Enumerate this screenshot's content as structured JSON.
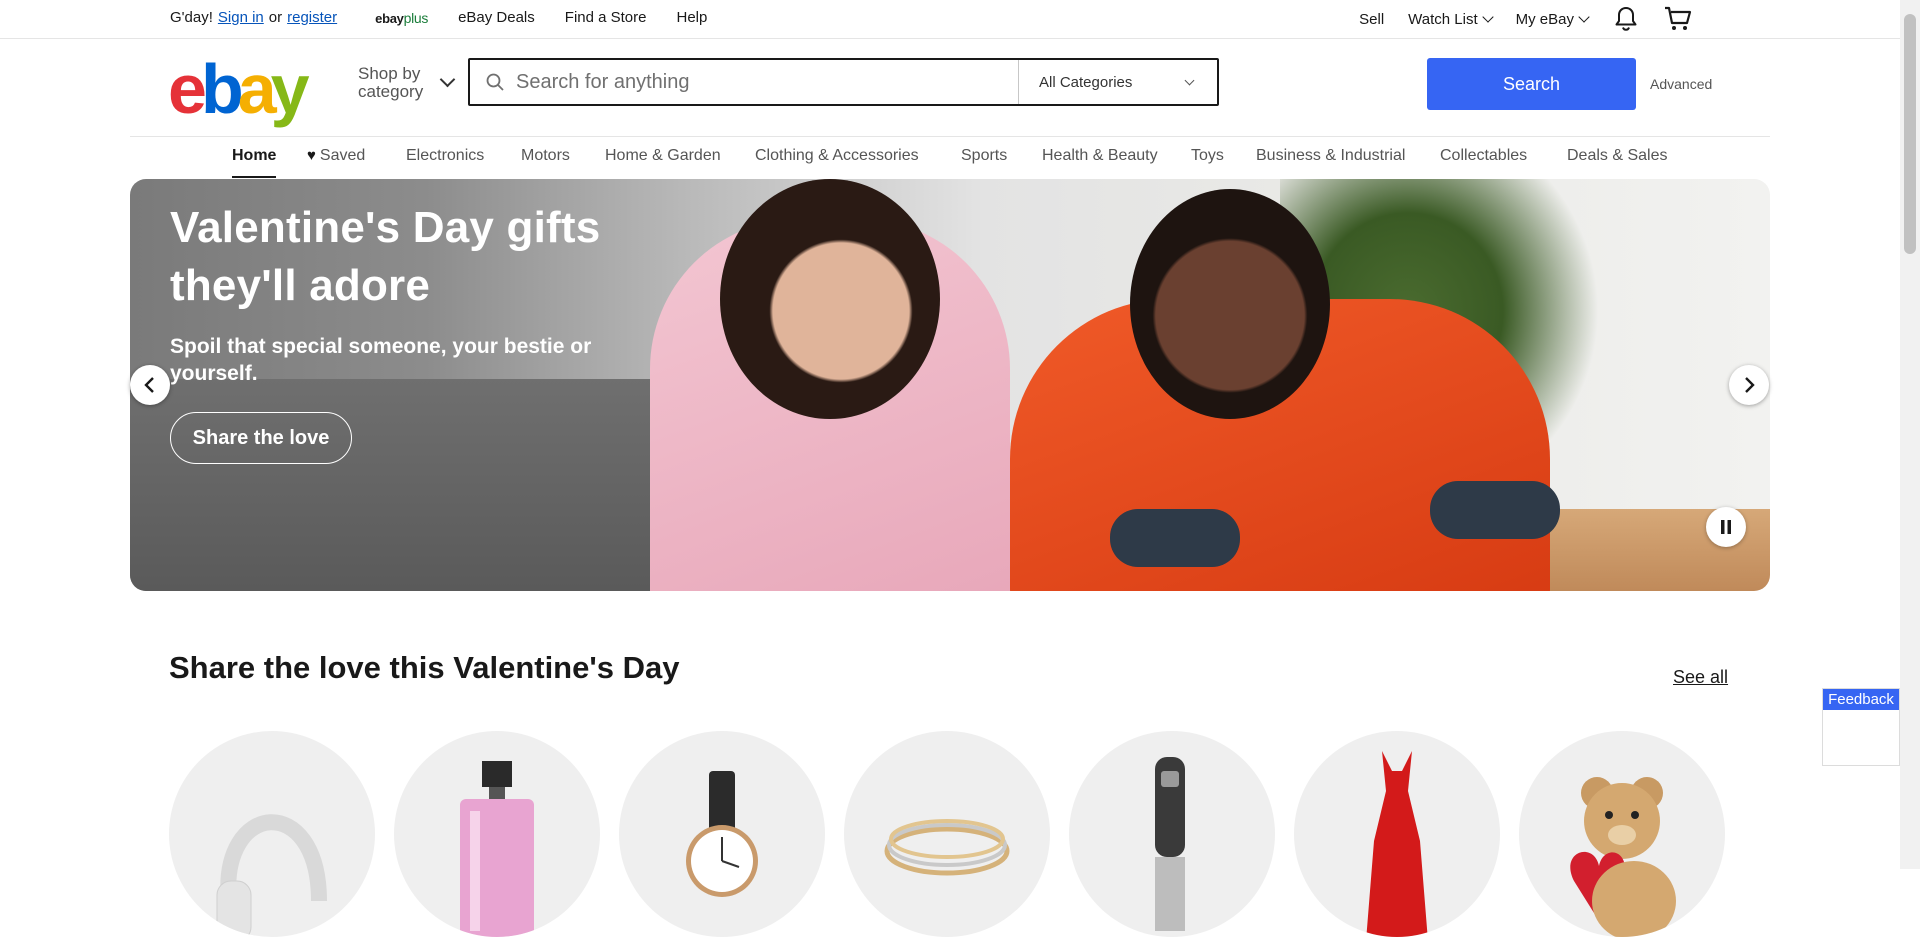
{
  "topbar": {
    "greeting": "G'day!",
    "sign_in": "Sign in",
    "or": "or",
    "register": "register",
    "ebayplus_ebay": "ebay",
    "ebayplus_plus": "plus",
    "links": [
      "eBay Deals",
      "Find a Store",
      "Help"
    ],
    "sell": "Sell",
    "watch_list": "Watch List",
    "my_ebay": "My eBay",
    "icons": [
      "bell-icon",
      "cart-icon"
    ]
  },
  "header": {
    "logo": {
      "e": "e",
      "b": "b",
      "a": "a",
      "y": "y"
    },
    "shop_by_line1": "Shop by",
    "shop_by_line2": "category",
    "search_placeholder": "Search for anything",
    "category_select": "All Categories",
    "search_button": "Search",
    "advanced": "Advanced"
  },
  "category_nav": [
    "Home",
    "Saved",
    "Electronics",
    "Motors",
    "Home & Garden",
    "Clothing & Accessories",
    "Sports",
    "Health & Beauty",
    "Toys",
    "Business & Industrial",
    "Collectables",
    "Deals & Sales"
  ],
  "hero": {
    "title": "Valentine's Day gifts they'll adore",
    "subtitle": "Spoil that special someone, your bestie or yourself.",
    "cta": "Share the love"
  },
  "section": {
    "title": "Share the love this Valentine's Day",
    "see_all": "See all",
    "items": [
      "headphones",
      "perfume",
      "watch",
      "bangles",
      "hair-tool",
      "red-dress",
      "teddy-bear"
    ]
  },
  "feedback": "Feedback",
  "colors": {
    "accent": "#3665f3",
    "link": "#0654ba"
  }
}
